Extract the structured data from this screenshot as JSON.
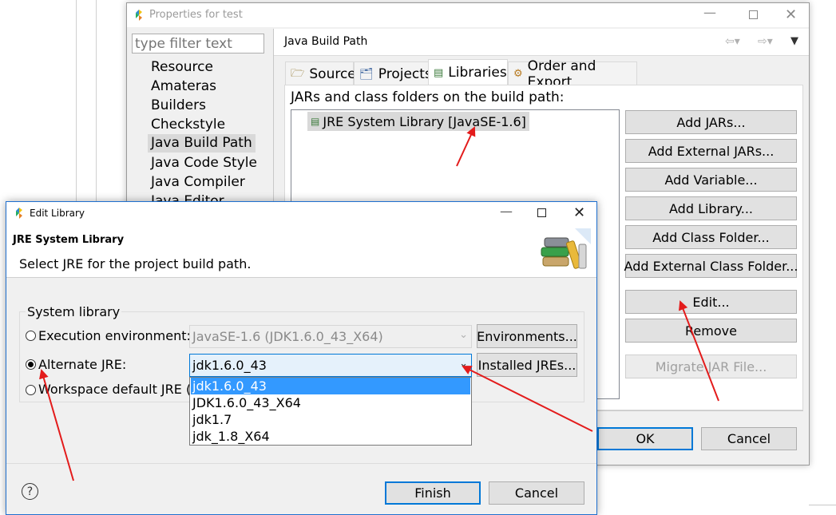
{
  "colors": {
    "accent": "#0078d7",
    "arrow": "#e31b1b",
    "selection": "#3399ff",
    "panel_bg": "#f0f0f0"
  },
  "properties_dialog": {
    "title": "Properties for test",
    "filter_placeholder": "type filter text",
    "nav_items": [
      "Resource",
      "Amateras",
      "Builders",
      "Checkstyle",
      "Java Build Path",
      "Java Code Style",
      "Java Compiler",
      "Java Editor"
    ],
    "selected_nav_item": "Java Build Path",
    "page_title": "Java Build Path",
    "tabs": [
      {
        "label": "Source",
        "icon": "source-folder-icon"
      },
      {
        "label": "Projects",
        "icon": "projects-icon"
      },
      {
        "label": "Libraries",
        "icon": "libraries-icon"
      },
      {
        "label": "Order and Export",
        "icon": "order-export-icon"
      }
    ],
    "active_tab": "Libraries",
    "list_caption": "JARs and class folders on the build path:",
    "library_entry": "JRE System Library [JavaSE-1.6]",
    "buttons": {
      "add_jars": "Add JARs...",
      "add_external_jars": "Add External JARs...",
      "add_variable": "Add Variable...",
      "add_library": "Add Library...",
      "add_class_folder": "Add Class Folder...",
      "add_external_class_folder": "Add External Class Folder...",
      "edit": "Edit...",
      "remove": "Remove",
      "migrate_jar": "Migrate JAR File...",
      "ok": "OK",
      "cancel": "Cancel"
    }
  },
  "edit_library_dialog": {
    "title": "Edit Library",
    "header_title": "JRE System Library",
    "header_desc": "Select JRE for the project build path.",
    "group_label": "System library",
    "exec_env_label": "Execution environment:",
    "exec_env_value": "JavaSE-1.6 (JDK1.6.0_43_X64)",
    "environments_button": "Environments...",
    "alternate_jre_label": "Alternate JRE:",
    "alternate_jre_value": "jdk1.6.0_43",
    "installed_jres_button": "Installed JREs...",
    "workspace_default_label": "Workspace default JRE (J",
    "dropdown_options": [
      "jdk1.6.0_43",
      "JDK1.6.0_43_X64",
      "jdk1.7",
      "jdk_1.8_X64"
    ],
    "selected_option": "jdk1.6.0_43",
    "finish_button": "Finish",
    "cancel_button": "Cancel"
  }
}
